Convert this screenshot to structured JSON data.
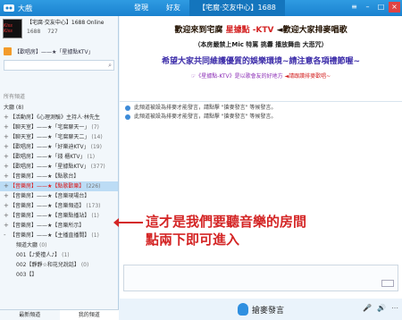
{
  "app": {
    "title": "大戲"
  },
  "nav": {
    "tabs": [
      "發現",
      "好友",
      "【宅腐‧交友中心】1688"
    ]
  },
  "room": {
    "name": "【宅腐‧交友中心】1688 Online",
    "id": "1688",
    "users": "727",
    "logo_text": "Kiss Kiss"
  },
  "breadcrumb": "【歡唱房】——★「星據點KTV」",
  "sidebar": {
    "section_label": "所有頻道",
    "root": "大廳 (8)",
    "channels": [
      {
        "sign": "+",
        "name": "【活動房】《心理測驗》主持人‧林先生",
        "count": "",
        "red": false,
        "highlight": false
      },
      {
        "sign": "+",
        "name": "【聊天室】——★「宅腐聊天一」",
        "count": "(7)",
        "red": false,
        "highlight": false
      },
      {
        "sign": "+",
        "name": "【聊天室】——★「宅腐聊天二」",
        "count": "(14)",
        "red": false,
        "highlight": false
      },
      {
        "sign": "+",
        "name": "【歡唱房】——★「好樂迪KTV」",
        "count": "(19)",
        "red": false,
        "highlight": false
      },
      {
        "sign": "+",
        "name": "【歡唱房】——★「錢 櫃KTV」",
        "count": "(1)",
        "red": false,
        "highlight": false
      },
      {
        "sign": "+",
        "name": "【歡唱房】——★「星據點KTV」",
        "count": "(377)",
        "red": false,
        "highlight": false
      },
      {
        "sign": "+",
        "name": "【音樂房】——★【點歌台】",
        "count": "",
        "red": false,
        "highlight": false
      },
      {
        "sign": "+",
        "name": "【音樂房】——★【點歌歡樂】",
        "count": "(226)",
        "red": true,
        "highlight": true
      },
      {
        "sign": "+",
        "name": "【音樂房】——★【音樂現場台】",
        "count": "",
        "red": false,
        "highlight": false
      },
      {
        "sign": "+",
        "name": "【音樂房】——★【音樂頻道】",
        "count": "(173)",
        "red": false,
        "highlight": false
      },
      {
        "sign": "+",
        "name": "【音樂房】——★【音樂點播站】",
        "count": "(1)",
        "red": false,
        "highlight": false
      },
      {
        "sign": "+",
        "name": "【音樂房】——★【音樂所示】",
        "count": "",
        "red": false,
        "highlight": false
      },
      {
        "sign": "-",
        "name": "【音樂房】——★【主播直播間】",
        "count": "(1)",
        "red": false,
        "highlight": false
      }
    ],
    "subchannels": [
      {
        "label": "頻道大廳",
        "count": "(0)"
      },
      {
        "label": "001【♪愛禮人♪】",
        "count": "(1)"
      },
      {
        "label": "002【靜靜☆和花兒說話】",
        "count": "(0)"
      },
      {
        "label": "003【】",
        "count": ""
      }
    ],
    "bottom_tabs": [
      "最新頻道",
      "我的頻道"
    ]
  },
  "banner": {
    "line1_a": "歡迎來到宅腐",
    "line1_b": "星據點 -KTV",
    "line1_c": "◄歡迎大家排麥唱歌",
    "line2": "（本房嚴禁上Mic 特罵 挑釁 播放舞曲 大悲咒）",
    "line3": "希望大家共同維護優質的娛樂環境~請注意各項禮節喔~",
    "line4_a": "☞《星據點-KTV》是以歌會友的好地方",
    "line4_b": "◄請跟讚排麥歡唱~"
  },
  "chat": {
    "notices": [
      "此頻道被設為排麥才能發言，請點擊 \"搶麥發言\" 等候發言。",
      "此頻道被設為排麥才能發言，請點擊 \"搶麥發言\" 等候發言。"
    ]
  },
  "annotation": {
    "line1": "這才是我們要聽音樂的房間",
    "line2": "點兩下即可進入"
  },
  "mic": {
    "label": "搶麥發言"
  },
  "colors": {
    "titlebar": "#1a82cf",
    "accent_red": "#d42525",
    "highlight": "#bcdcf5"
  }
}
